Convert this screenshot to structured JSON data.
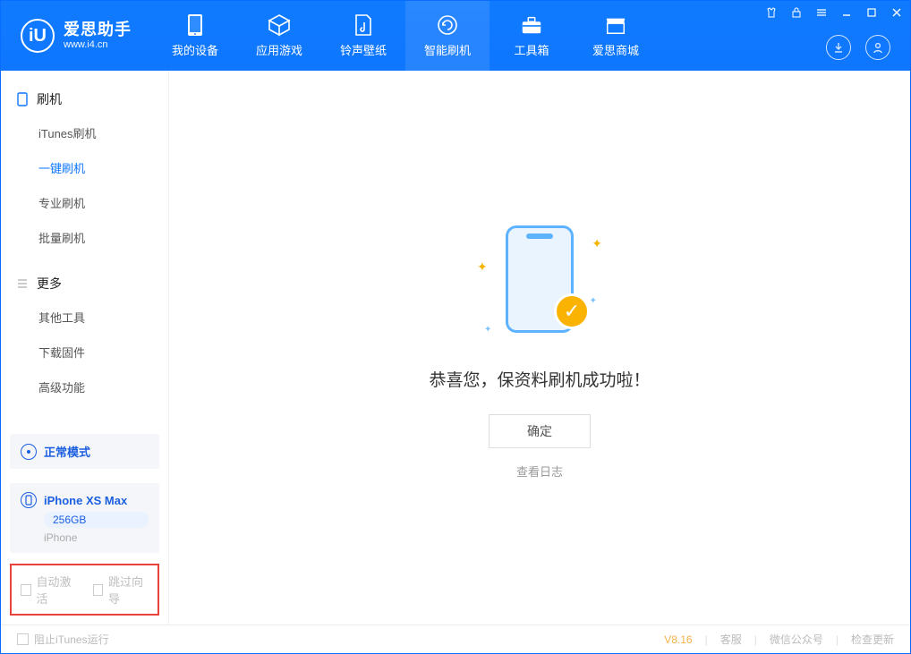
{
  "brand": {
    "title": "爱思助手",
    "subtitle": "www.i4.cn",
    "logo_letter": "iU"
  },
  "tabs": [
    {
      "label": "我的设备"
    },
    {
      "label": "应用游戏"
    },
    {
      "label": "铃声壁纸"
    },
    {
      "label": "智能刷机"
    },
    {
      "label": "工具箱"
    },
    {
      "label": "爱思商城"
    }
  ],
  "sidebar": {
    "cat_flash": "刷机",
    "flash_items": [
      "iTunes刷机",
      "一键刷机",
      "专业刷机",
      "批量刷机"
    ],
    "cat_more": "更多",
    "more_items": [
      "其他工具",
      "下载固件",
      "高级功能"
    ]
  },
  "mode": {
    "label": "正常模式"
  },
  "device": {
    "name": "iPhone XS Max",
    "capacity": "256GB",
    "type": "iPhone"
  },
  "options": {
    "auto_activate": "自动激活",
    "skip_guide": "跳过向导"
  },
  "main": {
    "success_title": "恭喜您，保资料刷机成功啦！",
    "ok_button": "确定",
    "view_log": "查看日志"
  },
  "statusbar": {
    "block_itunes": "阻止iTunes运行",
    "version": "V8.16",
    "support": "客服",
    "wechat": "微信公众号",
    "check_update": "检查更新"
  }
}
